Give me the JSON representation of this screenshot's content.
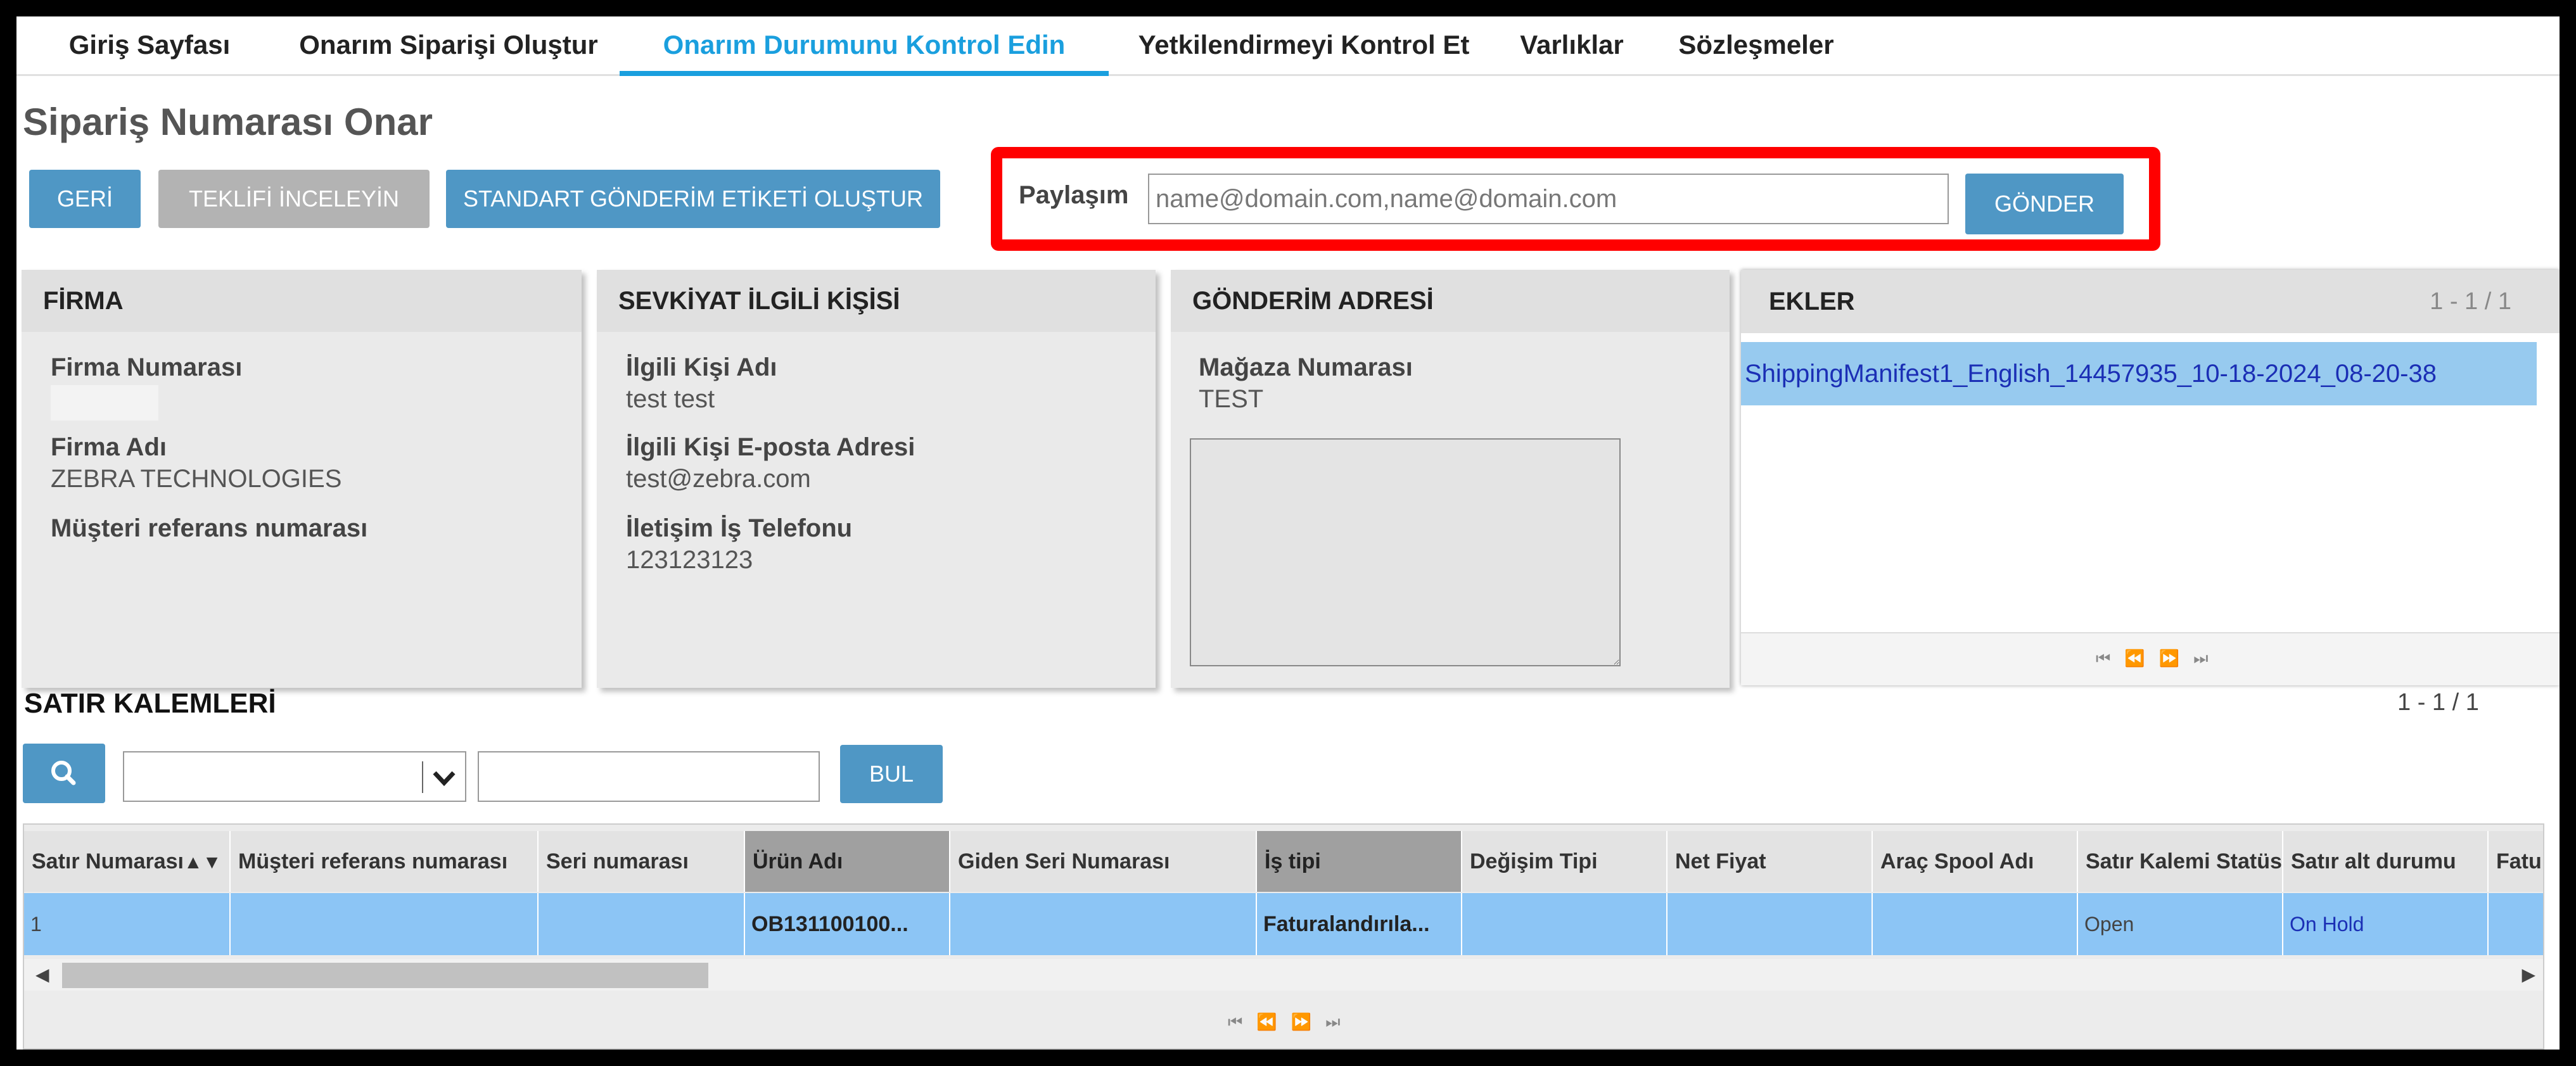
{
  "nav": {
    "tabs": [
      {
        "label": "Giriş Sayfası"
      },
      {
        "label": "Onarım Siparişi Oluştur"
      },
      {
        "label": "Onarım Durumunu Kontrol Edin"
      },
      {
        "label": "Yetkilendirmeyi Kontrol Et"
      },
      {
        "label": "Varlıklar"
      },
      {
        "label": "Sözleşmeler"
      }
    ],
    "active_index": 2
  },
  "page_title": "Sipariş Numarası Onar",
  "toolbar": {
    "back_label": "GERİ",
    "review_quote_label": "TEKLİFİ İNCELEYİN",
    "shipping_label_label": "STANDART GÖNDERİM ETİKETİ OLUŞTUR"
  },
  "share": {
    "label": "Paylaşım",
    "placeholder": "name@domain.com,name@domain.com",
    "value": "",
    "send_label": "GÖNDER"
  },
  "firma": {
    "title": "FİRMA",
    "firm_number_label": "Firma Numarası",
    "firm_number_value": "",
    "firm_name_label": "Firma Adı",
    "firm_name_value": "ZEBRA TECHNOLOGIES",
    "customer_ref_label": "Müşteri referans numarası",
    "customer_ref_value": ""
  },
  "contact": {
    "title": "SEVKİYAT İLGİLİ KİŞİSİ",
    "name_label": "İlgili Kişi Adı",
    "name_value": "test test",
    "email_label": "İlgili Kişi E-posta Adresi",
    "email_value": "test@zebra.com",
    "phone_label": "İletişim İş Telefonu",
    "phone_value": "123123123"
  },
  "shipping_address": {
    "title": "GÖNDERİM ADRESİ",
    "store_label": "Mağaza Numarası",
    "store_value": "TEST",
    "address_value": ""
  },
  "attachments": {
    "title": "EKLER",
    "count": "1 - 1 / 1",
    "items": [
      {
        "name": "ShippingManifest1_English_14457935_10-18-2024_08-20-38"
      }
    ]
  },
  "line_items": {
    "title": "SATIR KALEMLERİ",
    "count": "1 - 1 / 1",
    "search_value": "",
    "filter_select_value": "",
    "find_label": "BUL",
    "columns": [
      "Satır Numarası",
      "Müşteri referans numarası",
      "Seri numarası",
      "Ürün Adı",
      "Giden Seri Numarası",
      "İş tipi",
      "Değişim Tipi",
      "Net Fiyat",
      "Araç Spool Adı",
      "Satır Kalemi Statüsü",
      "Satır alt durumu",
      "Faturalandırma"
    ],
    "sort_indicator": "▲▼",
    "rows": [
      {
        "line_no": "1",
        "customer_ref": "",
        "serial": "",
        "product": "OB131100100...",
        "out_serial": "",
        "job_type": "Faturalandırıla...",
        "exchange_type": "",
        "net_price": "",
        "spool": "",
        "status": "Open",
        "sub_status": "On Hold",
        "billing": ""
      }
    ]
  },
  "colors": {
    "accent": "#1a9fde",
    "button_blue": "#4f97c5",
    "button_gray": "#b3b3b3",
    "selected_row": "#8cc5f5",
    "highlight_box": "#ff0000"
  },
  "icons": {
    "search": "search-icon",
    "dropdown": "chevron-down-icon",
    "pager": [
      "first-page-icon",
      "prev-page-icon",
      "next-page-icon",
      "last-page-icon"
    ],
    "scroll": [
      "scroll-left-icon",
      "scroll-right-icon"
    ]
  }
}
